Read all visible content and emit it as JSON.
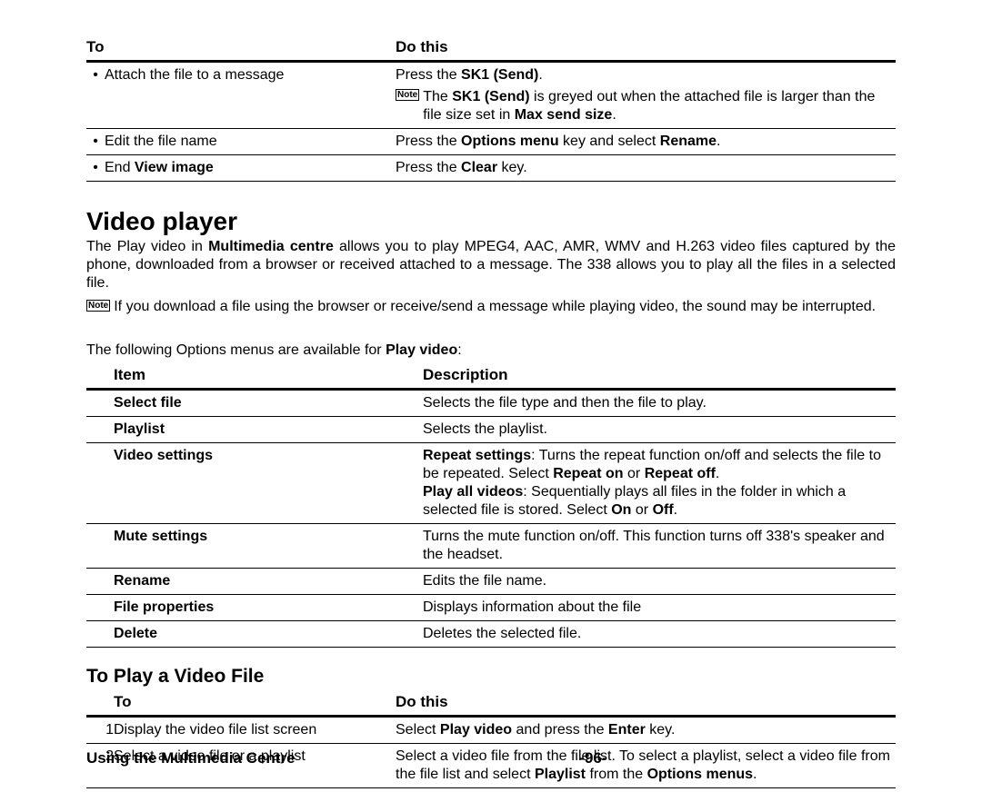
{
  "table1": {
    "headers": {
      "to": "To",
      "do": "Do this"
    },
    "rows": [
      {
        "to": "Attach the file to a message",
        "do_html": "Press the <span class='b'>SK1 (Send)</span>.",
        "note_html": "The <span class='b'>SK1 (Send)</span> is greyed out when the attached file is larger than the file size set in <span class='b'>Max send size</span>."
      },
      {
        "to": "Edit the file name",
        "do_html": "Press the <span class='b'>Options menu</span> key and select <span class='b'>Rename</span>."
      },
      {
        "to_html": "End <span class='b'>View image</span>",
        "do_html": "Press the <span class='b'>Clear</span> key."
      }
    ]
  },
  "section": {
    "title": "Video player",
    "body_html": "The Play video in <span class='b'>Multimedia centre</span> allows you to play MPEG4, AAC, AMR, WMV and H.263 video files captured by the phone, downloaded from a browser or received attached to a message. The 338 allows you to play all the files in a selected file.",
    "note": "If you download a file using the browser or receive/send a message while playing video, the sound may be interrupted.",
    "options_intro_html": "The following Options menus are available for <span class='b'>Play video</span>:"
  },
  "table2": {
    "headers": {
      "item": "Item",
      "desc": "Description"
    },
    "rows": [
      {
        "item": "Select file",
        "desc_html": "Selects the file type and then the file to play."
      },
      {
        "item": "Playlist",
        "desc_html": "Selects the playlist."
      },
      {
        "item": "Video settings",
        "desc_html": "<span class='b'>Repeat settings</span>: Turns the repeat function on/off and selects the file to be repeated. Select <span class='b'>Repeat on</span> or <span class='b'>Repeat off</span>.<br><span class='b'>Play all videos</span>: Sequentially plays all files in the folder in which a selected file is stored. Select <span class='b'>On</span> or <span class='b'>Off</span>."
      },
      {
        "item": "Mute settings",
        "desc_html": "Turns the mute function on/off. This function turns off 338's speaker and the headset."
      },
      {
        "item": "Rename",
        "desc_html": "Edits the file name."
      },
      {
        "item": "File properties",
        "desc_html": "Displays information about the file"
      },
      {
        "item": "Delete",
        "desc_html": "Deletes the selected file."
      }
    ]
  },
  "sub_title": "To Play a Video File",
  "table3": {
    "headers": {
      "to": "To",
      "do": "Do this"
    },
    "rows": [
      {
        "num": "1",
        "to": "Display the video file list screen",
        "do_html": "Select <span class='b'>Play video</span> and press the <span class='b'>Enter</span> key."
      },
      {
        "num": "2",
        "to": "Select a video file or a playlist",
        "do_html": "Select a video file from the file list. To select a playlist, select a video file from the file list and select <span class='b'>Playlist</span> from the <span class='b'>Options menus</span>."
      }
    ]
  },
  "footer": {
    "left": "Using the Multimedia Centre",
    "page": "-96-"
  },
  "note_label": "Note"
}
